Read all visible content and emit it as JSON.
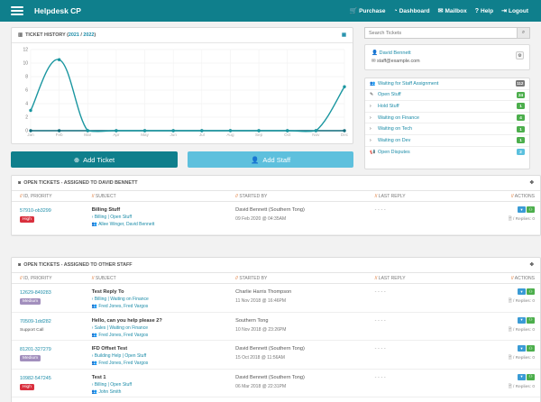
{
  "header": {
    "brand": "Helpdesk CP",
    "nav": [
      {
        "icon": "cart-icon",
        "glyph": "🛒",
        "label": "Purchase"
      },
      {
        "icon": "dashboard-icon",
        "glyph": "◔",
        "label": "Dashboard"
      },
      {
        "icon": "mailbox-icon",
        "glyph": "✉",
        "label": "Mailbox"
      },
      {
        "icon": "help-icon",
        "glyph": "?",
        "label": "Help"
      },
      {
        "icon": "logout-icon",
        "glyph": "⇥",
        "label": "Logout"
      }
    ]
  },
  "history": {
    "title": "TICKET HISTORY (",
    "year1": "2021",
    "slash": " / ",
    "year2": "2022",
    "close": ")"
  },
  "chart_data": {
    "type": "line",
    "categories": [
      "Jan",
      "Feb",
      "Mar",
      "Apr",
      "May",
      "Jun",
      "Jul",
      "Aug",
      "Sep",
      "Oct",
      "Nov",
      "Dec"
    ],
    "series": [
      {
        "values": [
          3,
          10.5,
          0,
          0,
          0,
          0,
          0,
          0,
          0,
          0,
          0,
          6.5
        ],
        "color": "#1a96a0"
      },
      {
        "values": [
          0,
          0,
          0,
          0,
          0,
          0,
          0,
          0,
          0,
          0,
          0,
          0
        ],
        "color": "#0f6a7a"
      }
    ],
    "ylim": [
      0,
      12
    ],
    "yticks": [
      0,
      2,
      4,
      6,
      8,
      10,
      12
    ],
    "grid": true
  },
  "buttons": {
    "add_ticket": "Add Ticket",
    "add_staff": "Add Staff"
  },
  "search": {
    "placeholder": "Search Tickets"
  },
  "user": {
    "name": "David Bennett",
    "email": "staff@example.com"
  },
  "filters": [
    {
      "label": "Waiting for Staff Assignment",
      "count": "112",
      "color": "#777777",
      "icon": "👥"
    },
    {
      "label": "Open Stuff",
      "count": "24",
      "color": "#4cae4c",
      "icon": "✎"
    },
    {
      "label": "Hold Stuff",
      "count": "1",
      "color": "#4cae4c",
      "icon": "›"
    },
    {
      "label": "Waiting on Finance",
      "count": "4",
      "color": "#4cae4c",
      "icon": "›"
    },
    {
      "label": "Waiting on Tech",
      "count": "1",
      "color": "#4cae4c",
      "icon": "›"
    },
    {
      "label": "Waiting on Dev",
      "count": "1",
      "color": "#4cae4c",
      "icon": "›"
    },
    {
      "label": "Open Disputes",
      "count": "2",
      "color": "#5bc0de",
      "icon": "📢"
    }
  ],
  "table_headers": [
    "// ID, PRIORITY",
    "// SUBJECT",
    "// STARTED BY",
    "// LAST REPLY",
    "// ACTIONS"
  ],
  "assigned": {
    "title": "OPEN TICKETS - ASSIGNED TO DAVID BENNETT",
    "rows": [
      {
        "id": "57910-ob3299",
        "tag": "High",
        "tag_color": "#d9303e",
        "subject": "Billing Stuff",
        "meta1": "Billing | Open Stuff",
        "meta2": "Allee Winger, David Bennett",
        "started": "David Bennett (Southern Tong)",
        "date": "09 Feb 2020 @ 04:35AM",
        "last": "- - - -",
        "replies": "/ Replies: 0"
      }
    ]
  },
  "other": {
    "title": "OPEN TICKETS - ASSIGNED TO OTHER STAFF",
    "rows": [
      {
        "id": "12629-849283",
        "tag": "Medium",
        "tag_color": "#a28fbd",
        "subject": "Test Reply To",
        "meta1": "Billing | Waiting on Finance",
        "meta2": "Fred Jones, Fred Vargos",
        "started": "Charlie Harris Thompson",
        "date": "11 Nov 2018 @ 16:46PM",
        "last": "- - - -",
        "replies": "/ Replies: 0"
      },
      {
        "id": "70509-1dd282",
        "tag": "Support Call",
        "tag_color": "",
        "subject": "Hello, can you help please 2?",
        "meta1": "Sales | Waiting on Finance",
        "meta2": "Fred Jones, Fred Vargos",
        "started": "Southern Tong",
        "date": "10 Nov 2018 @ 23:26PM",
        "last": "- - - -",
        "replies": "/ Replies: 0"
      },
      {
        "id": "81201-327279",
        "tag": "Medium",
        "tag_color": "#a28fbd",
        "subject": "IFD Offset Test",
        "meta1": "Building Help | Open Stuff",
        "meta2": "Fred Jones, Fred Vargos",
        "started": "David Bennett (Southern Tong)",
        "date": "15 Oct 2018 @ 11:56AM",
        "last": "- - - -",
        "replies": "/ Replies: 0"
      },
      {
        "id": "10982-547245",
        "tag": "High",
        "tag_color": "#d9303e",
        "subject": "Test 1",
        "meta1": "Billing | Open Stuff",
        "meta2": "John Smith",
        "started": "David Bennett (Southern Tong)",
        "date": "06 Mar 2018 @ 22:31PM",
        "last": "- - - -",
        "replies": "/ Replies: 0"
      }
    ]
  }
}
